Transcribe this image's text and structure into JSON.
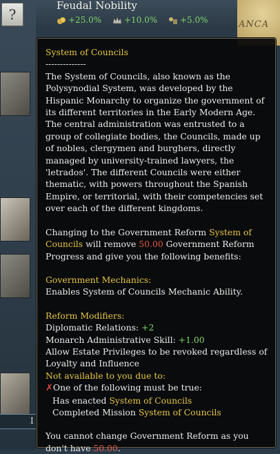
{
  "background": {
    "help_button": "?",
    "title": "Feudal Nobility",
    "modifiers": [
      {
        "icon": "gold-coins-icon",
        "value": "+25.0%"
      },
      {
        "icon": "crown-icon",
        "value": "+10.0%"
      },
      {
        "icon": "trade-icon",
        "value": "+5.0%"
      }
    ],
    "map_label": "ANCA",
    "edge_label": "I"
  },
  "tooltip": {
    "title": "System of Councils",
    "separator": "--------------",
    "description": "The System of Councils, also known as the Polysynodial System, was developed by the Hispanic Monarchy to organize the government of its different territories in the Early Modern Age. The central administration was entrusted to a group of collegiate bodies, the Councils, made up of nobles, clergymen and burghers, directly managed by university-trained lawyers, the 'letrados'. The different Councils were either thematic, with powers throughout the Spanish Empire, or territorial, with their competencies set over each of the different kingdoms.",
    "change": {
      "prefix": "Changing to the Government Reform ",
      "reform": "System of Councils",
      "mid": " will remove ",
      "cost": "50.00",
      "suffix": " Government Reform Progress and give you the following benefits:"
    },
    "mechanics_heading": "Government Mechanics:",
    "mechanics_text": "Enables System of Councils Mechanic Ability.",
    "modifiers_heading": "Reform Modifiers:",
    "modifiers": [
      {
        "label": "Diplomatic Relations: ",
        "value": "+2"
      },
      {
        "label": "Monarch Administrative Skill: ",
        "value": "+1.00"
      }
    ],
    "privileges_text": "Allow Estate Privileges to be revoked regardless of Loyalty and Influence",
    "not_available_heading": "Not available to you due to:",
    "condition_header": "One of the following must be true:",
    "conditions": [
      {
        "prefix": "Has enacted ",
        "value": "System of Councils"
      },
      {
        "prefix": "Completed Mission ",
        "value": "System of Councils"
      }
    ],
    "footer": {
      "prefix": "You cannot change Government Reform as you don't have ",
      "value": "50.00",
      "suffix": "."
    }
  }
}
